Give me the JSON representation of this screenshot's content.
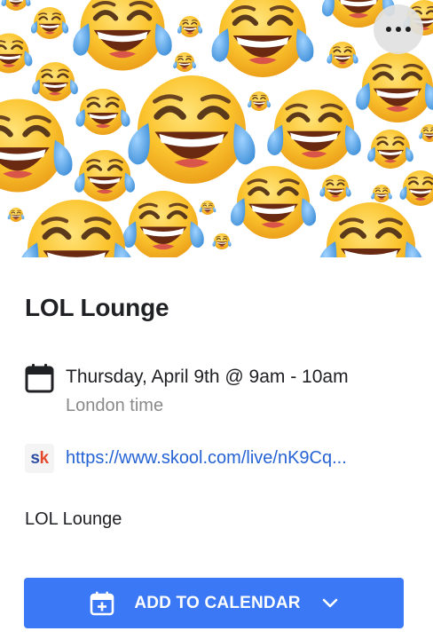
{
  "hero": {
    "image_icon": "laughing-tears-emoji-pattern",
    "more_icon": "more-horizontal-icon"
  },
  "event": {
    "title": "LOL Lounge",
    "date_icon": "calendar-icon",
    "date_time": "Thursday, April 9th @ 9am - 10am",
    "timezone": "London time",
    "link_icon": "skool-logo",
    "link_logo_text": "sk",
    "link_url": "https://www.skool.com/live/nK9Cq...",
    "description": "LOL Lounge"
  },
  "actions": {
    "add_to_calendar_label": "ADD TO CALENDAR",
    "add_icon": "calendar-add-icon",
    "dropdown_icon": "chevron-down-icon"
  },
  "colors": {
    "primary": "#3b78f6",
    "link": "#2563d4",
    "muted": "#8a8a8a",
    "emoji_yellow": "#f7b928",
    "tear_blue": "#4a9fe0"
  }
}
